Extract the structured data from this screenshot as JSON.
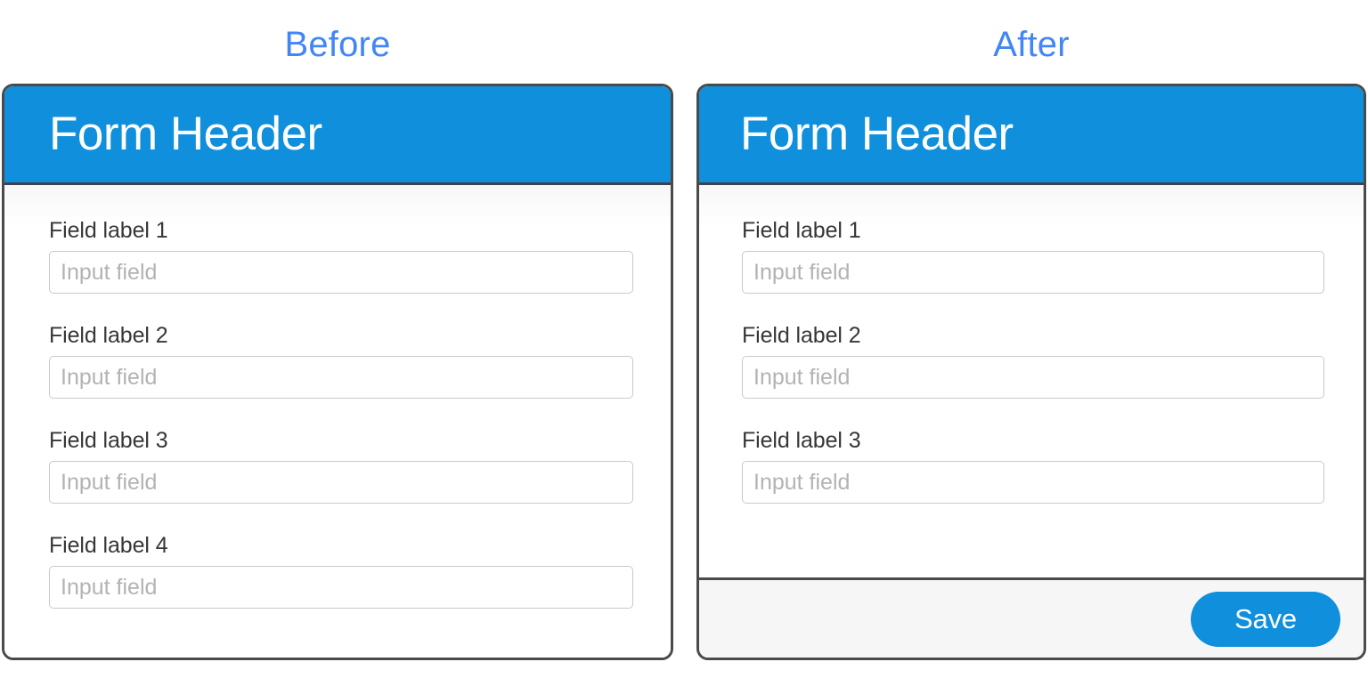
{
  "columns": {
    "before_caption": "Before",
    "after_caption": "After"
  },
  "colors": {
    "caption": "#4286f5",
    "header_blue": "#0f8fdc",
    "card_border": "#4a4a4a",
    "footer_bg": "#f6f6f6",
    "label_text": "#373737",
    "placeholder_text": "#b3b3b3",
    "input_border": "#c9c9c9",
    "button_blue": "#0f8fdc",
    "button_text": "#ffffff"
  },
  "before_card": {
    "header_title": "Form Header",
    "fields": [
      {
        "label": "Field label 1",
        "value": "",
        "placeholder": "Input field"
      },
      {
        "label": "Field label 2",
        "value": "",
        "placeholder": "Input field"
      },
      {
        "label": "Field label 3",
        "value": "",
        "placeholder": "Input field"
      },
      {
        "label": "Field label 4",
        "value": "",
        "placeholder": "Input field"
      }
    ],
    "has_footer": false
  },
  "after_card": {
    "header_title": "Form Header",
    "fields": [
      {
        "label": "Field label 1",
        "value": "",
        "placeholder": "Input field"
      },
      {
        "label": "Field label 2",
        "value": "",
        "placeholder": "Input field"
      },
      {
        "label": "Field label 3",
        "value": "",
        "placeholder": "Input field"
      }
    ],
    "has_footer": true,
    "footer": {
      "save_label": "Save"
    }
  }
}
